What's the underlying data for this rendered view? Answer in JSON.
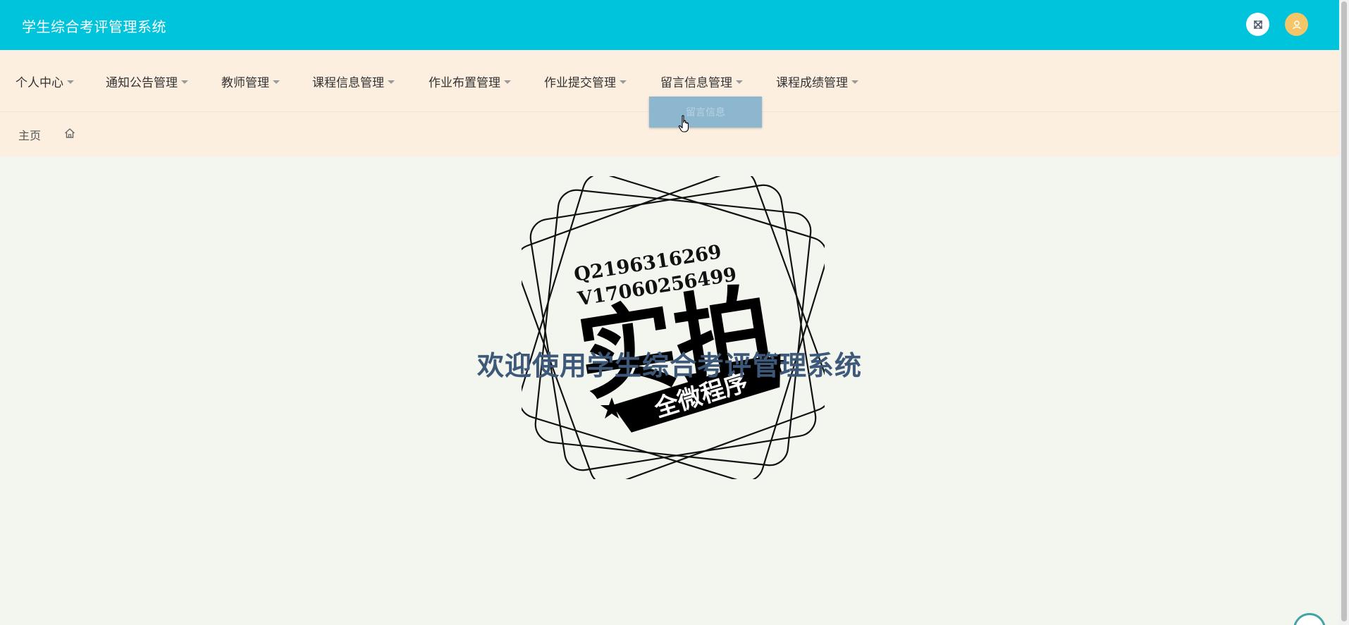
{
  "header": {
    "title": "学生综合考评管理系统",
    "color": "#00c3dc"
  },
  "nav": {
    "items": [
      {
        "label": "个人中心"
      },
      {
        "label": "通知公告管理"
      },
      {
        "label": "教师管理"
      },
      {
        "label": "课程信息管理"
      },
      {
        "label": "作业布置管理"
      },
      {
        "label": "作业提交管理"
      },
      {
        "label": "留言信息管理"
      },
      {
        "label": "课程成绩管理"
      }
    ],
    "open_dropdown": {
      "parent": "留言信息管理",
      "items": [
        {
          "label": "留言信息"
        }
      ]
    }
  },
  "breadcrumb": {
    "home_label": "主页"
  },
  "main": {
    "welcome_text": "欢迎使用学生综合考评管理系统"
  },
  "watermark": {
    "line1": "Q2196316269",
    "line2": "V17060256499",
    "big_text": "实拍",
    "ribbon_text": "全微程序"
  },
  "colors": {
    "navbar_bg": "#fcefe0",
    "main_bg": "#f2f6ef",
    "welcome": "#3d5878",
    "avatar": "#f5c56a",
    "dropdown_bg": "#8db6cf"
  },
  "icons": {
    "fullscreen": "expand-arrows-icon",
    "avatar": "user-icon",
    "home": "home-icon",
    "cursor": "hand-pointer-icon"
  }
}
